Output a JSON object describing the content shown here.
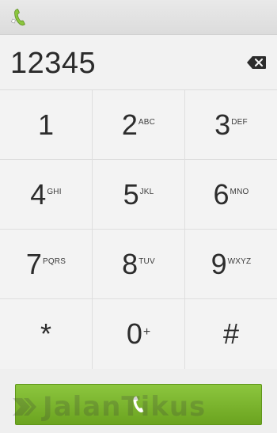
{
  "display": {
    "number": "12345"
  },
  "icons": {
    "app": "phone-handset-icon",
    "backspace": "backspace-icon",
    "call": "phone-handset-icon"
  },
  "keypad": [
    {
      "digit": "1",
      "letters": ""
    },
    {
      "digit": "2",
      "letters": "ABC"
    },
    {
      "digit": "3",
      "letters": "DEF"
    },
    {
      "digit": "4",
      "letters": "GHI"
    },
    {
      "digit": "5",
      "letters": "JKL"
    },
    {
      "digit": "6",
      "letters": "MNO"
    },
    {
      "digit": "7",
      "letters": "PQRS"
    },
    {
      "digit": "8",
      "letters": "TUV"
    },
    {
      "digit": "9",
      "letters": "WXYZ"
    },
    {
      "digit": "*",
      "letters": ""
    },
    {
      "digit": "0",
      "letters": "+"
    },
    {
      "digit": "#",
      "letters": ""
    }
  ],
  "watermark": {
    "text": "JalanTikus"
  },
  "colors": {
    "call_button": "#7ab52a",
    "call_icon": "#ffffff",
    "digit_text": "#2c2c2c"
  }
}
